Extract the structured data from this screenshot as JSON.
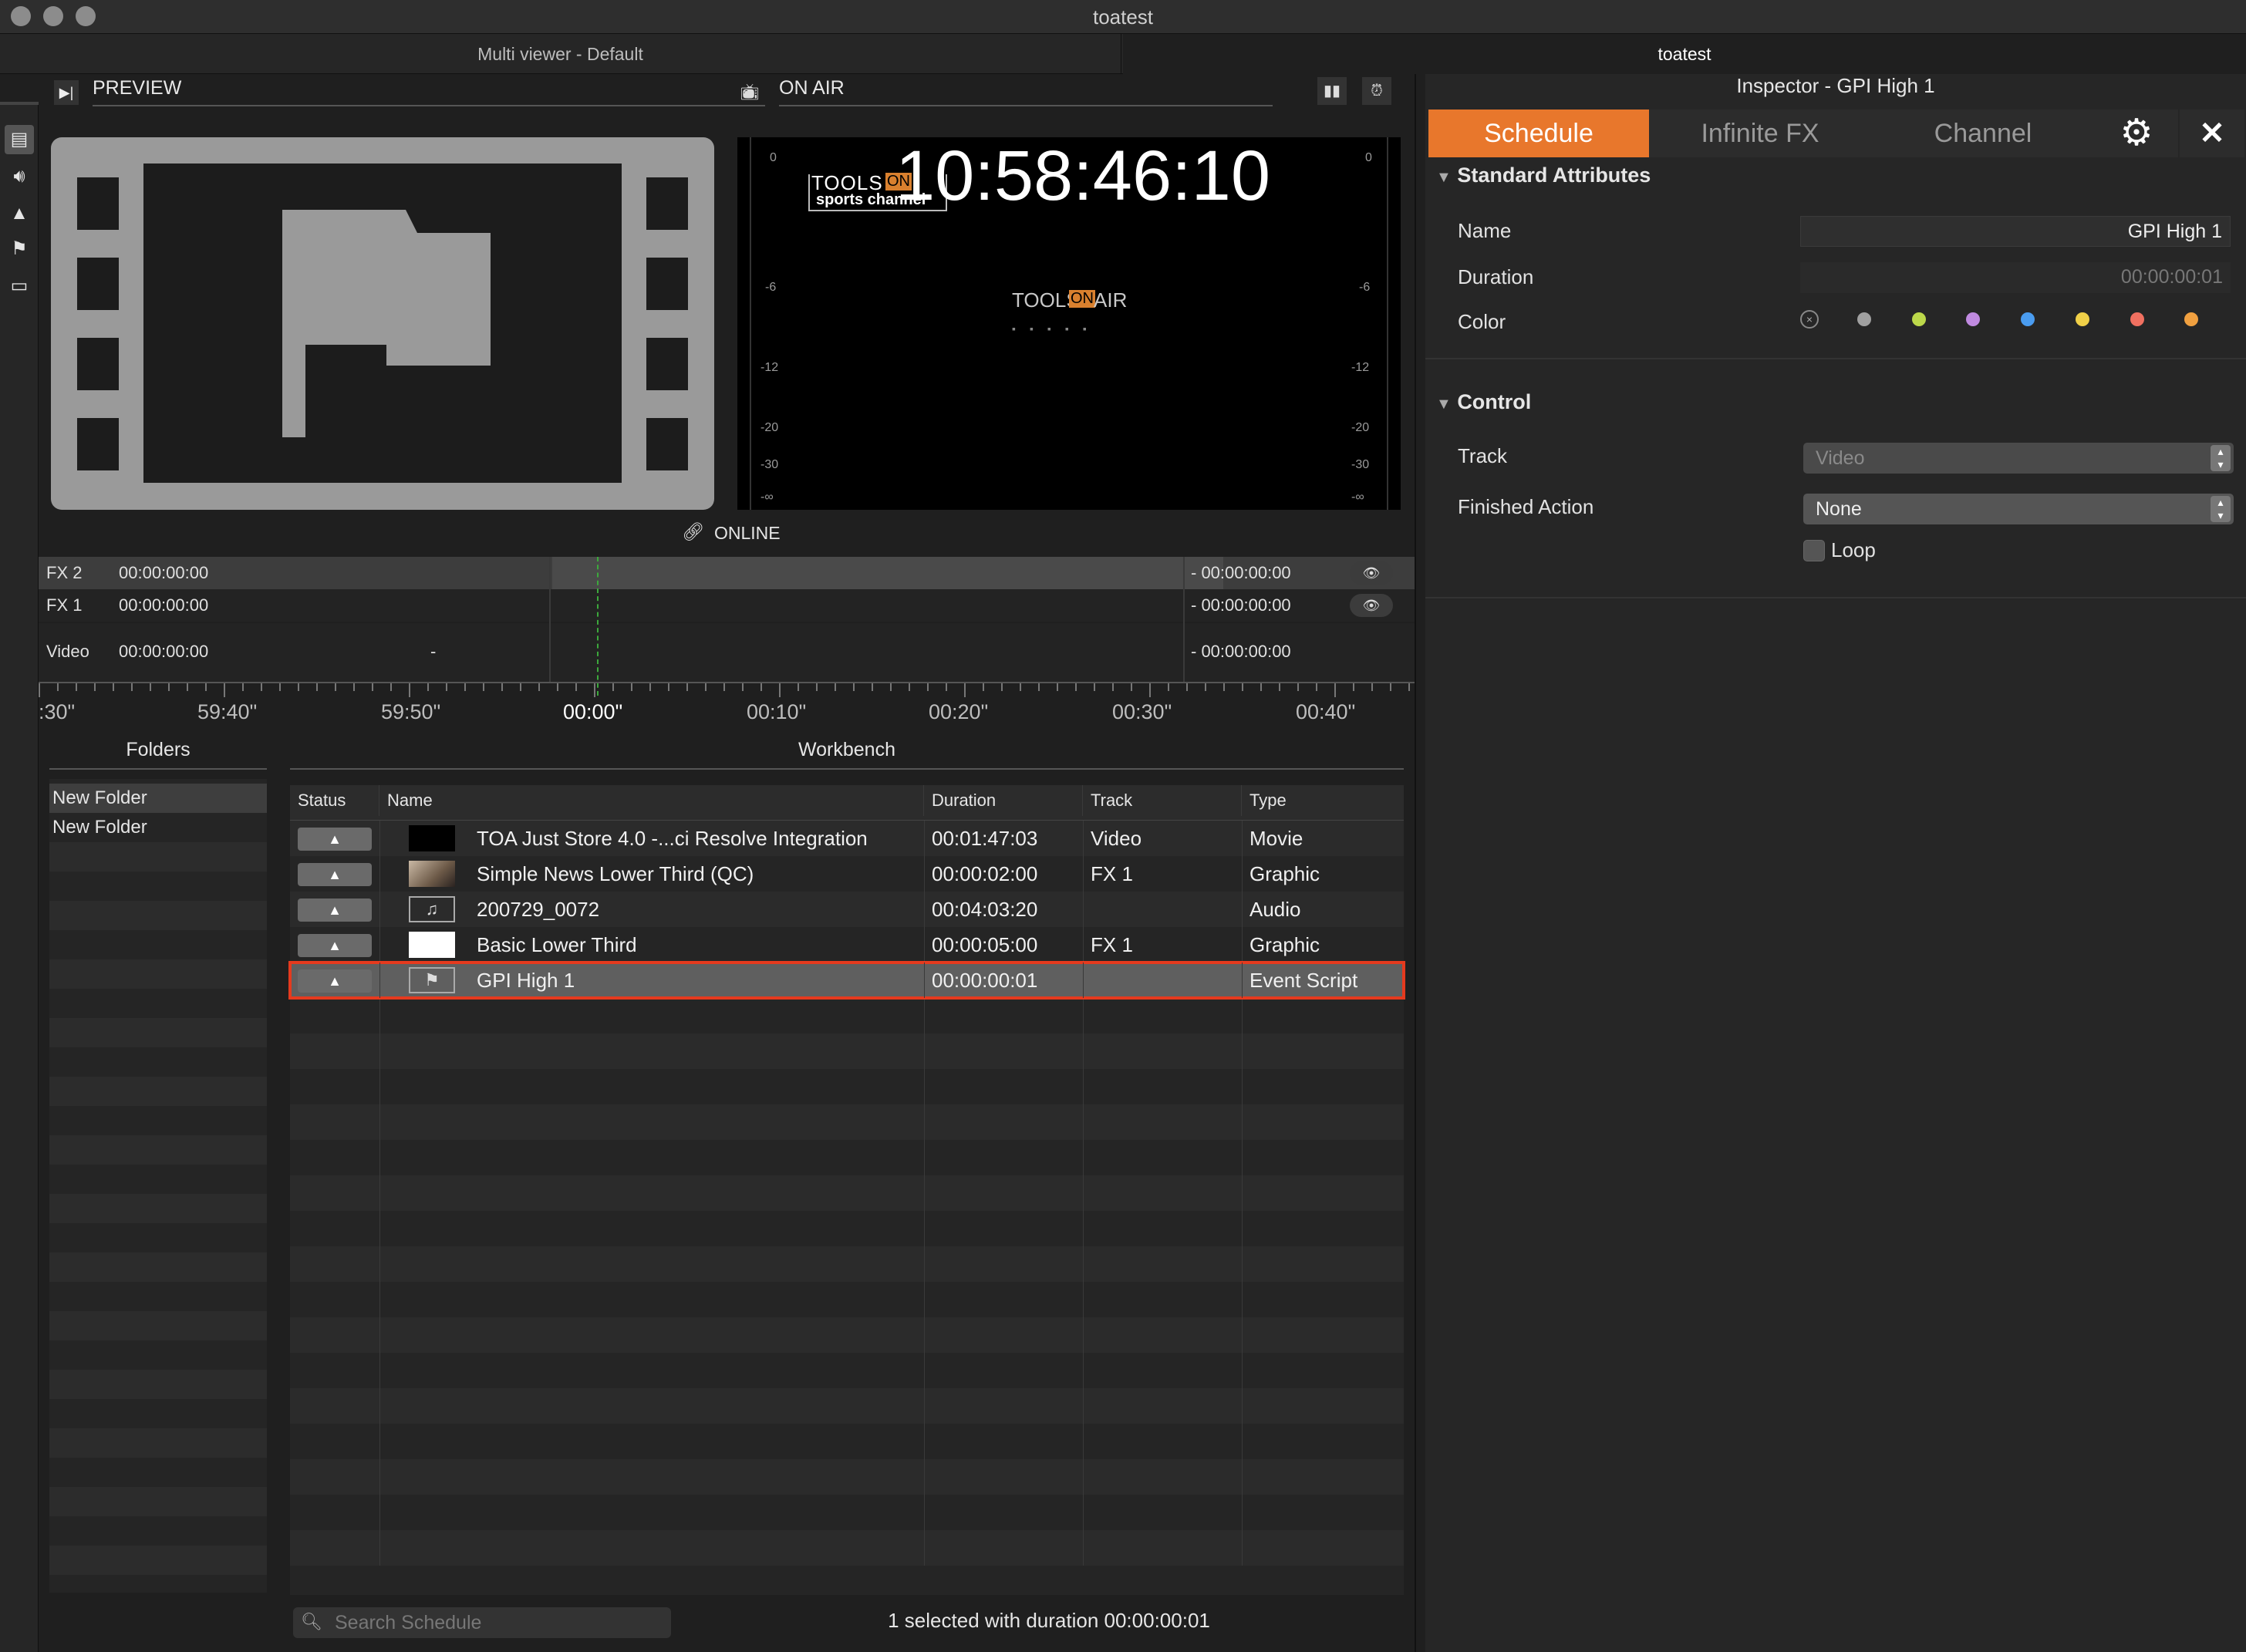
{
  "window": {
    "title": "toatest"
  },
  "tabs": [
    {
      "label": "Multi viewer - Default"
    },
    {
      "label": "toatest"
    }
  ],
  "preview": {
    "label": "PREVIEW"
  },
  "onair": {
    "label": "ON AIR",
    "timecode": "10:58:46:10",
    "status": "ONLINE",
    "logo_text": "TOOLS",
    "logo_on": "ON",
    "logo_air": "AIR",
    "channel_text": "sports channel",
    "meter_scale": [
      "0",
      "-6",
      "-12",
      "-20",
      "-30",
      "-∞"
    ]
  },
  "timeline": {
    "rows": [
      {
        "name": "FX 2",
        "start": "00:00:00:00",
        "mid": "",
        "end": "- 00:00:00:00",
        "has_eye": true
      },
      {
        "name": "FX 1",
        "start": "00:00:00:00",
        "mid": "",
        "end": "- 00:00:00:00",
        "has_eye": true
      },
      {
        "name": "Video",
        "start": "00:00:00:00",
        "mid": "-",
        "end": "- 00:00:00:00",
        "has_eye": false
      }
    ],
    "ruler": [
      ":30\"",
      "59:40\"",
      "59:50\"",
      "00:00\"",
      "00:10\"",
      "00:20\"",
      "00:30\"",
      "00:40\""
    ]
  },
  "folders": {
    "title": "Folders",
    "items": [
      "New Folder",
      "New Folder"
    ]
  },
  "workbench": {
    "title": "Workbench",
    "columns": [
      "Status",
      "Name",
      "Duration",
      "Track",
      "Type"
    ],
    "rows": [
      {
        "name": "TOA Just Store 4.0 -...ci Resolve Integration",
        "duration": "00:01:47:03",
        "track": "Video",
        "type": "Movie",
        "thumb": "black",
        "selected": false
      },
      {
        "name": "Simple News Lower Third (QC)",
        "duration": "00:00:02:00",
        "track": "FX 1",
        "type": "Graphic",
        "thumb": "image",
        "selected": false
      },
      {
        "name": "200729_0072",
        "duration": "00:04:03:20",
        "track": "",
        "type": "Audio",
        "thumb": "audio",
        "selected": false
      },
      {
        "name": "Basic Lower Third",
        "duration": "00:00:05:00",
        "track": "FX 1",
        "type": "Graphic",
        "thumb": "white",
        "selected": false
      },
      {
        "name": "GPI High 1",
        "duration": "00:00:00:01",
        "track": "",
        "type": "Event Script",
        "thumb": "flag",
        "selected": true
      }
    ],
    "status_glyph": "▲",
    "search_placeholder": "Search Schedule",
    "summary": "1 selected with duration 00:00:00:01"
  },
  "inspector": {
    "title": "Inspector - GPI High 1",
    "tabs": [
      "Schedule",
      "Infinite FX",
      "Channel"
    ],
    "active_tab": "Schedule",
    "standard_section": "Standard Attributes",
    "name_label": "Name",
    "name_value": "GPI High 1",
    "duration_label": "Duration",
    "duration_value": "00:00:00:01",
    "color_label": "Color",
    "colors": [
      "none",
      "#a0a0a0",
      "#bcd84a",
      "#c08ae0",
      "#4a9cf0",
      "#f0d048",
      "#f07060",
      "#f0a040"
    ],
    "control_section": "Control",
    "track_label": "Track",
    "track_value": "Video",
    "finished_label": "Finished Action",
    "finished_value": "None",
    "loop_label": "Loop"
  },
  "accent": "#e8772c"
}
